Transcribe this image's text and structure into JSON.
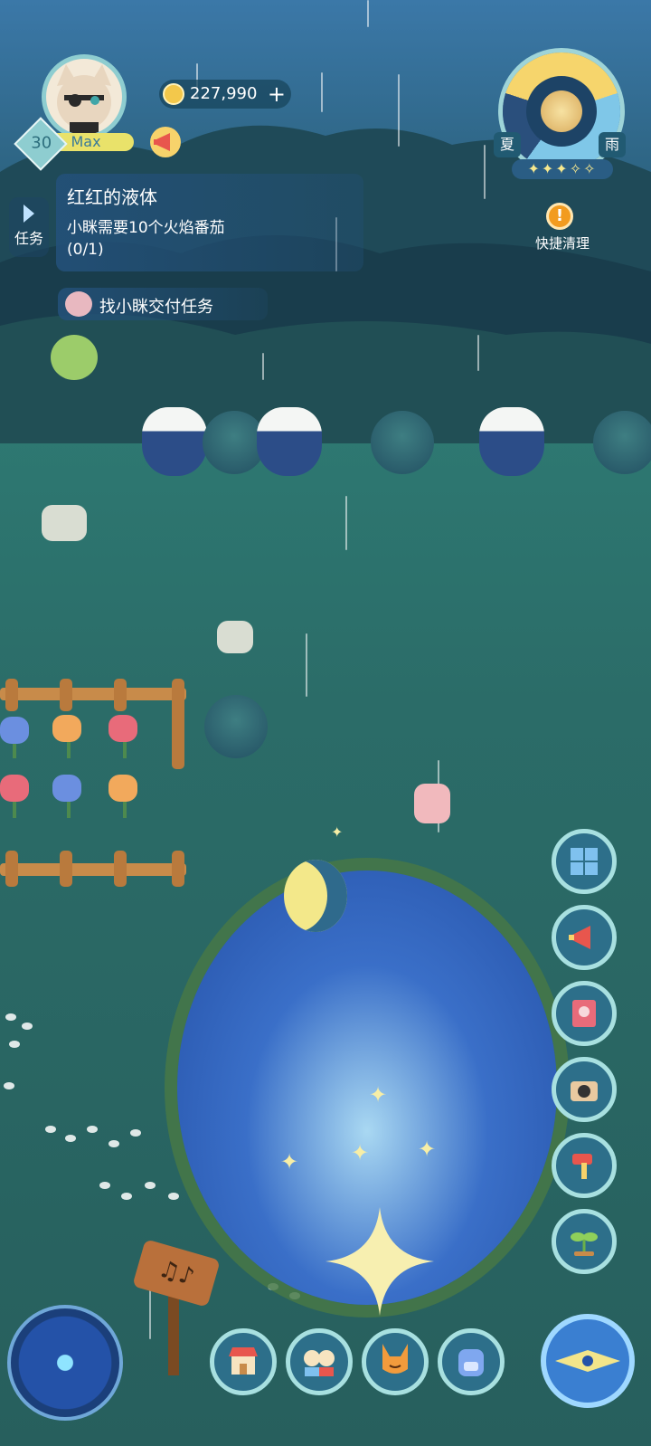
{
  "player": {
    "level": "30",
    "level_status": "Max",
    "coins": "227,990",
    "coins_plus": "+"
  },
  "quest": {
    "tab_label": "任务",
    "title": "红红的液体",
    "description": "小眯需要10个火焰番茄",
    "progress": "(0/1)",
    "hint": "找小眯交付任务"
  },
  "weather": {
    "season": "夏",
    "condition": "雨",
    "stars_filled": 3,
    "stars_total": 5,
    "stars_display": "✦✦✦✧✧",
    "quick_clean_icon": "!",
    "quick_clean_label": "快捷清理"
  },
  "sign": {
    "glyph": "♫♪"
  },
  "right_buttons": [
    "calendar-icon",
    "megaphone-icon",
    "book-icon",
    "camera-icon",
    "hammer-icon",
    "sprout-icon"
  ],
  "bottom_buttons": [
    "shop-icon",
    "friends-icon",
    "fox-icon",
    "backpack-icon"
  ],
  "colors": {
    "accent_gold": "#f3c84b",
    "button_ring": "#a8e0e0",
    "button_fill": "#2d6f8a"
  }
}
